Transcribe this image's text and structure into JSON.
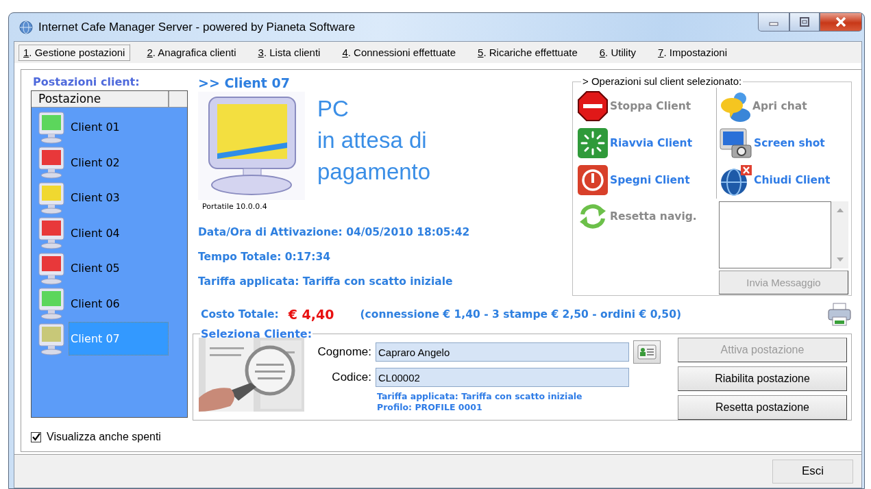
{
  "window": {
    "title": "Internet Cafe Manager Server - powered by Pianeta Software"
  },
  "tabs": [
    {
      "label": "1. Gestione postazioni",
      "selected": true
    },
    {
      "label": "2. Anagrafica clienti",
      "selected": false
    },
    {
      "label": "3. Lista clienti",
      "selected": false
    },
    {
      "label": "4. Connessioni effettuate",
      "selected": false
    },
    {
      "label": "5. Ricariche effettuate",
      "selected": false
    },
    {
      "label": "6. Utility",
      "selected": false
    },
    {
      "label": "7. Impostazioni",
      "selected": false
    }
  ],
  "clients_panel": {
    "title": "Postazioni client:",
    "column": "Postazione",
    "clients": [
      {
        "name": "Client 01",
        "color": "#5cd65c",
        "selected": false
      },
      {
        "name": "Client 02",
        "color": "#e8383a",
        "selected": false
      },
      {
        "name": "Client 03",
        "color": "#f0d830",
        "selected": false
      },
      {
        "name": "Client 04",
        "color": "#e8383a",
        "selected": false
      },
      {
        "name": "Client 05",
        "color": "#e8383a",
        "selected": false
      },
      {
        "name": "Client 06",
        "color": "#5cd65c",
        "selected": false
      },
      {
        "name": "Client 07",
        "color": "#c8c878",
        "selected": true
      }
    ],
    "show_off": {
      "label": "Visualizza anche spenti",
      "checked": true
    }
  },
  "detail": {
    "heading": ">> Client 07",
    "status": [
      "PC",
      "in attesa di",
      "pagamento"
    ],
    "caption": "Portatile 10.0.0.4",
    "lines": [
      "Data/Ora di Attivazione: 04/05/2010 18:05:42",
      "Tempo Totale: 0:17:34",
      "Tariffa applicata: Tariffa con scatto iniziale"
    ],
    "cost": {
      "label": "Costo Totale:",
      "value": "€ 4,40",
      "detail": "(connessione € 1,40 - 3 stampe € 2,50 - ordini € 0,50)"
    }
  },
  "operations": {
    "title": "> Operazioni sul client selezionato:",
    "actions": [
      {
        "kind": "stop",
        "label": "Stoppa Client",
        "disabled": true
      },
      {
        "kind": "chat",
        "label": "Apri chat",
        "disabled": true
      },
      {
        "kind": "restart",
        "label": "Riavvia Client",
        "disabled": false
      },
      {
        "kind": "screenshot",
        "label": "Screen shot",
        "disabled": false
      },
      {
        "kind": "power",
        "label": "Spegni Client",
        "disabled": false
      },
      {
        "kind": "close",
        "label": "Chiudi Client",
        "disabled": false
      }
    ],
    "reset": {
      "kind": "reset",
      "label": "Resetta navig.",
      "disabled": true
    },
    "send_button": {
      "label": "Invia Messaggio",
      "disabled": true
    }
  },
  "selection": {
    "title": "Seleziona Cliente:",
    "fields": [
      {
        "label": "Cognome:",
        "value": "Capraro Angelo"
      },
      {
        "label": "Codice:",
        "value": "CL00002"
      }
    ],
    "info": [
      "Tariffa applicata: Tariffa con scatto iniziale",
      "Profilo: PROFILE 0001"
    ],
    "buttons": [
      {
        "label": "Attiva postazione",
        "disabled": true
      },
      {
        "label": "Riabilita postazione",
        "disabled": false
      },
      {
        "label": "Resetta postazione",
        "disabled": false
      }
    ]
  },
  "footer": {
    "exit_button": "Esci"
  }
}
